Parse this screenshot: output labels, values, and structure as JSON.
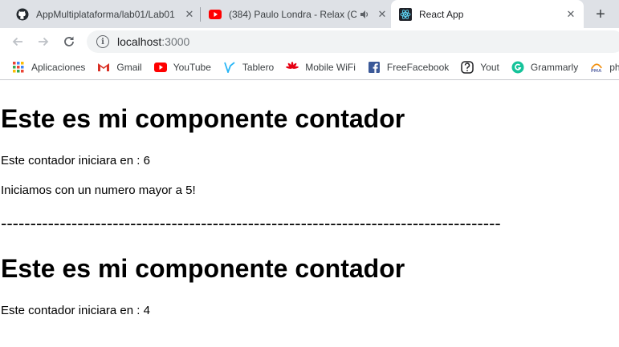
{
  "tabs": [
    {
      "title": "AppMultiplataforma/lab01/Lab01",
      "icon": "github-icon"
    },
    {
      "title": "(384) Paulo Londra - Relax (C",
      "icon": "youtube-icon"
    },
    {
      "title": "React App",
      "icon": "react-icon"
    }
  ],
  "address_bar": {
    "host": "localhost",
    "port": ":3000"
  },
  "bookmarks": [
    {
      "label": "Aplicaciones",
      "icon": "apps-grid-icon"
    },
    {
      "label": "Gmail",
      "icon": "gmail-icon"
    },
    {
      "label": "YouTube",
      "icon": "youtube-icon"
    },
    {
      "label": "Tablero",
      "icon": "tablero-icon"
    },
    {
      "label": "Mobile WiFi",
      "icon": "huawei-icon"
    },
    {
      "label": "FreeFacebook",
      "icon": "facebook-icon"
    },
    {
      "label": "Yout",
      "icon": "yout-icon"
    },
    {
      "label": "Grammarly",
      "icon": "grammarly-icon"
    },
    {
      "label": "ph",
      "icon": "pma-icon"
    }
  ],
  "page": {
    "heading1": "Este es mi componente contador",
    "counter1_text": "Este contador iniciara en : 6",
    "message": "Iniciamos con un numero mayor a 5!",
    "divider": "-------------------------------------------------------------------------------------",
    "heading2": "Este es mi componente contador",
    "counter2_text": "Este contador iniciara en : 4"
  },
  "colors": {
    "tabstrip": "#dee1e6",
    "youtube_red": "#ff0000",
    "react_blue": "#61dafb",
    "facebook_blue": "#3b5998",
    "grammarly_green": "#15c39a"
  }
}
